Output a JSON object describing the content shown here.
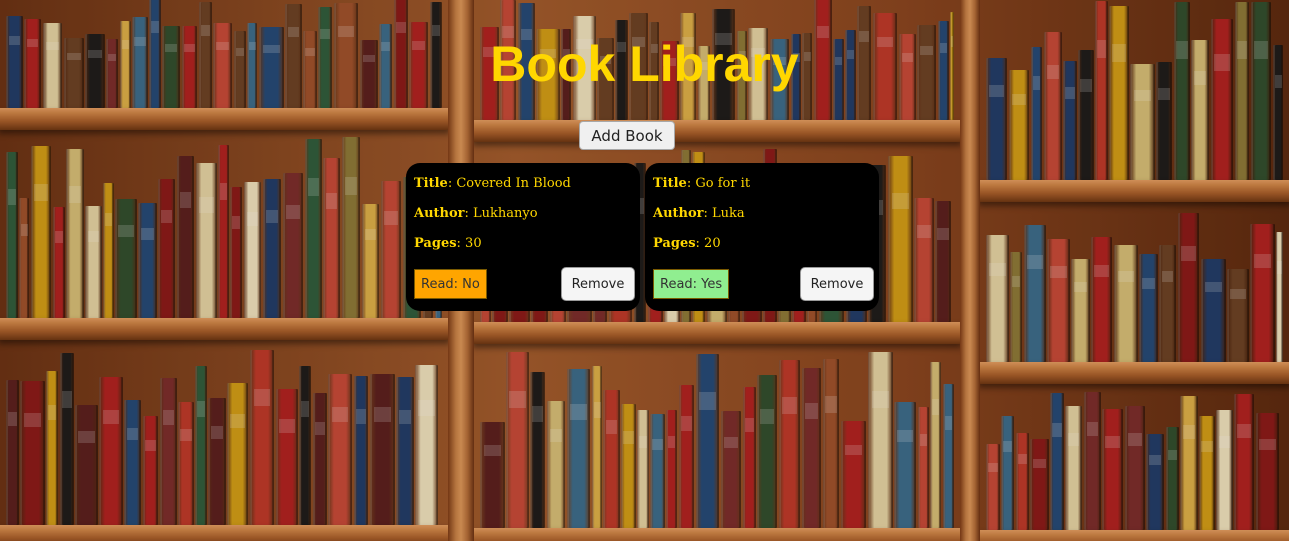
{
  "header": {
    "title": "Book Library",
    "add_book_label": "Add Book",
    "title_color": "#ffd700"
  },
  "books": [
    {
      "title_label": "Title",
      "title_value": "Covered In Blood",
      "author_label": "Author",
      "author_value": "Lukhanyo",
      "pages_label": "Pages",
      "pages_value": "30",
      "read_status": "Read: No",
      "read_color": "#ffa500",
      "remove_label": "Remove"
    },
    {
      "title_label": "Title",
      "title_value": "Go for it",
      "author_label": "Author",
      "author_value": "Luka",
      "pages_label": "Pages",
      "pages_value": "20",
      "read_status": "Read: Yes",
      "read_color": "#90ee90",
      "remove_label": "Remove"
    }
  ],
  "colors": {
    "card_background": "#000000",
    "card_text": "#ffd700"
  }
}
